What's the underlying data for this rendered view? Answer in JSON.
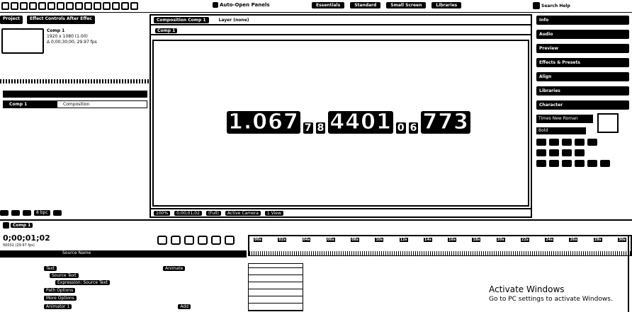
{
  "toolbar": {
    "auto_open_panels": "Auto-Open Panels",
    "workspaces": [
      "Essentials",
      "Standard",
      "Small Screen",
      "Libraries"
    ],
    "search_help": "Search Help"
  },
  "project": {
    "tab_project": "Project",
    "tab_effect_controls": "Effect Controls After Effec",
    "comp_name": "Comp 1",
    "comp_info_1": "1920 x 1080 (1.00)",
    "comp_info_2": "Δ 0;00;30;00, 29.97 fps",
    "item_name": "Comp 1",
    "item_type": "Composition",
    "bpc": "8 bpc"
  },
  "composition": {
    "tab_label": "Composition Comp 1",
    "layer_label": "Layer (none)",
    "sub_tab": "Comp 1",
    "readout": {
      "value1": "1.067",
      "sep1": "7",
      "sep2": "8",
      "value2": "4401",
      "sep3": "0",
      "sep4": "6",
      "value3": "773"
    },
    "zoom": "100%",
    "timecode": "0;00;01;02",
    "quality": "(Full)",
    "camera": "Active Camera",
    "views": "1 View"
  },
  "right_panels": [
    "Info",
    "Audio",
    "Preview",
    "Effects & Presets",
    "Align",
    "Libraries",
    "Character"
  ],
  "character": {
    "font": "Times New Roman",
    "style": "Bold"
  },
  "timeline": {
    "tab": "Comp 1",
    "timecode": "0;00;01;02",
    "timecode_sub": "00032 (29.97 fps)",
    "col_header": "Source Name",
    "layers": [
      {
        "label": "Source Text",
        "indent": 70
      },
      {
        "label": "Expression: Source Text",
        "indent": 70
      },
      {
        "label": "Path Options",
        "indent": 62
      },
      {
        "label": "More Options",
        "indent": 62
      },
      {
        "label": "Animator 1",
        "indent": 62
      }
    ],
    "animate_label": "Animate",
    "add_label": "Add",
    "ruler_ticks": [
      "00s",
      "02s",
      "04s",
      "06s",
      "08s",
      "10s",
      "12s",
      "14s",
      "16s",
      "18s",
      "20s",
      "22s",
      "24s",
      "26s",
      "28s",
      "30s"
    ]
  },
  "watermark": {
    "line1": "Activate Windows",
    "line2": "Go to PC settings to activate Windows."
  }
}
